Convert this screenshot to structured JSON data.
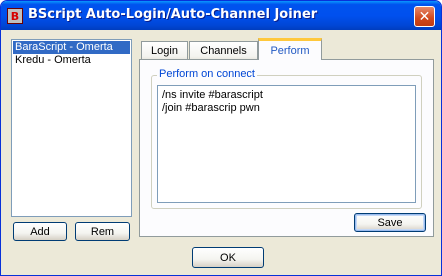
{
  "window": {
    "title": "BScript Auto-Login/Auto-Channel Joiner",
    "icon_label": "B"
  },
  "accounts": {
    "items": [
      "BaraScript - Omerta",
      "Kredu - Omerta"
    ],
    "selected_index": 0
  },
  "buttons": {
    "add": "Add",
    "rem": "Rem",
    "save": "Save",
    "ok": "OK"
  },
  "tabs": [
    "Login",
    "Channels",
    "Perform"
  ],
  "active_tab": "Perform",
  "perform": {
    "group_label": "Perform on connect",
    "lines": [
      "/ns invite #barascript",
      "/join #barascrip pwn"
    ]
  },
  "colors": {
    "titlebar": "#0054e3",
    "selection": "#316ac5",
    "active_tab_text": "#2159c3",
    "group_label": "#0046d5"
  }
}
